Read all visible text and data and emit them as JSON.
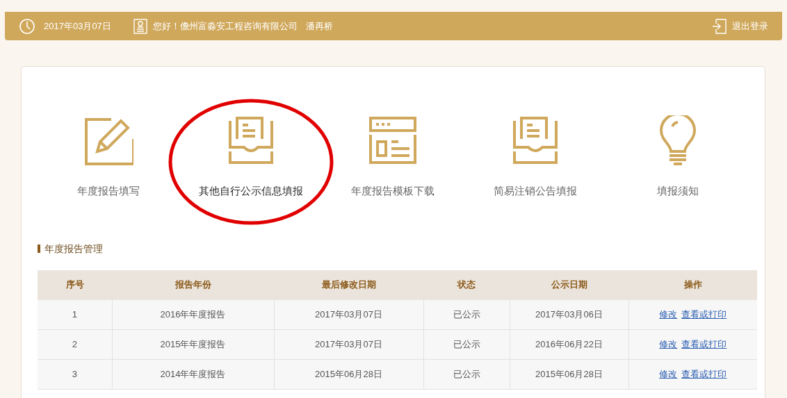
{
  "top_bar": {
    "date": "2017年03月07日",
    "greeting": "您好！儋州富淼安工程咨询有限公司",
    "user": "潘再桥",
    "logout": "退出登录"
  },
  "tiles": [
    {
      "kind": "edit",
      "label": "年度报告填写",
      "highlighted": false
    },
    {
      "kind": "inbox",
      "label": "其他自行公示信息填报",
      "highlighted": true
    },
    {
      "kind": "template",
      "label": "年度报告模板下载",
      "highlighted": false
    },
    {
      "kind": "inbox",
      "label": "简易注销公告填报",
      "highlighted": false
    },
    {
      "kind": "bulb",
      "label": "填报须知",
      "highlighted": false
    }
  ],
  "section_title": "年度报告管理",
  "table": {
    "columns": [
      "序号",
      "报告年份",
      "最后修改日期",
      "状态",
      "公示日期",
      "操作"
    ],
    "rows": [
      {
        "cells": [
          "1",
          "2016年年度报告",
          "2017年03月07日",
          "已公示",
          "2017年03月06日"
        ],
        "actions": [
          "修改",
          "查看或打印"
        ]
      },
      {
        "cells": [
          "2",
          "2015年年度报告",
          "2017年03月07日",
          "已公示",
          "2016年06月22日"
        ],
        "actions": [
          "修改",
          "查看或打印"
        ]
      },
      {
        "cells": [
          "3",
          "2014年年度报告",
          "2015年06月28日",
          "已公示",
          "2015年06月28日"
        ],
        "actions": [
          "修改",
          "查看或打印"
        ]
      }
    ]
  }
}
